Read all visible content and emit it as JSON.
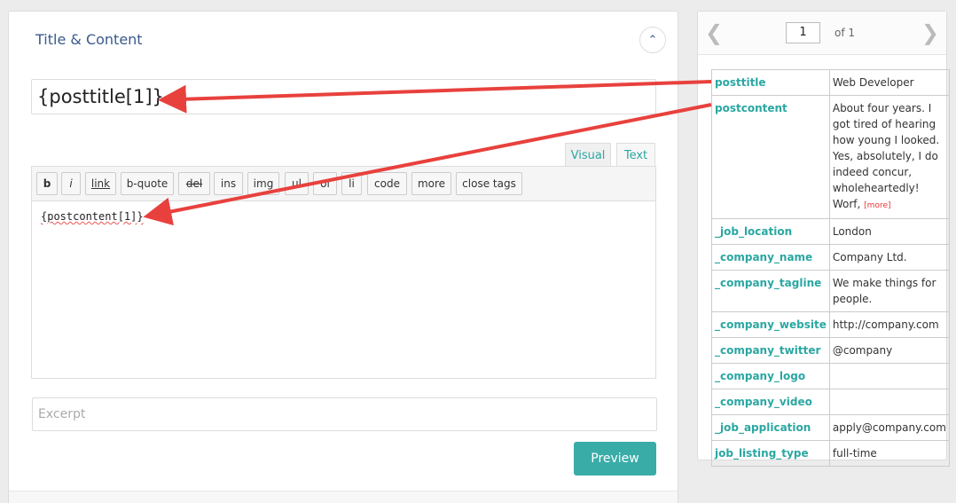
{
  "panel": {
    "title": "Title & Content",
    "title_input_value": "{posttitle[1]}",
    "tabs": {
      "visual": "Visual",
      "text": "Text"
    },
    "toolbar": [
      "b",
      "i",
      "link",
      "b-quote",
      "del",
      "ins",
      "img",
      "ul",
      "ol",
      "li",
      "code",
      "more",
      "close tags"
    ],
    "editor_content": "{postcontent[1]}",
    "excerpt_placeholder": "Excerpt",
    "preview_label": "Preview"
  },
  "pager": {
    "current_page": "1",
    "of_text": "of 1"
  },
  "fields": [
    {
      "key": "posttitle",
      "value": "Web Developer"
    },
    {
      "key": "postcontent",
      "value": "About four years. I got tired of hearing how young I looked. Yes, absolutely, I do indeed concur, wholeheartedly! Worf,",
      "more": "[more]"
    },
    {
      "key": "_job_location",
      "value": "London"
    },
    {
      "key": "_company_name",
      "value": "Company Ltd."
    },
    {
      "key": "_company_tagline",
      "value": "We make things for people."
    },
    {
      "key": "_company_website",
      "value": "http://company.com"
    },
    {
      "key": "_company_twitter",
      "value": "@company"
    },
    {
      "key": "_company_logo",
      "value": ""
    },
    {
      "key": "_company_video",
      "value": ""
    },
    {
      "key": "_job_application",
      "value": "apply@company.com"
    },
    {
      "key": "job_listing_type",
      "value": "full-time"
    }
  ],
  "colors": {
    "accent": "#3aaca7",
    "title_blue": "#3a5a8c",
    "arrow_red": "#e8413d"
  }
}
